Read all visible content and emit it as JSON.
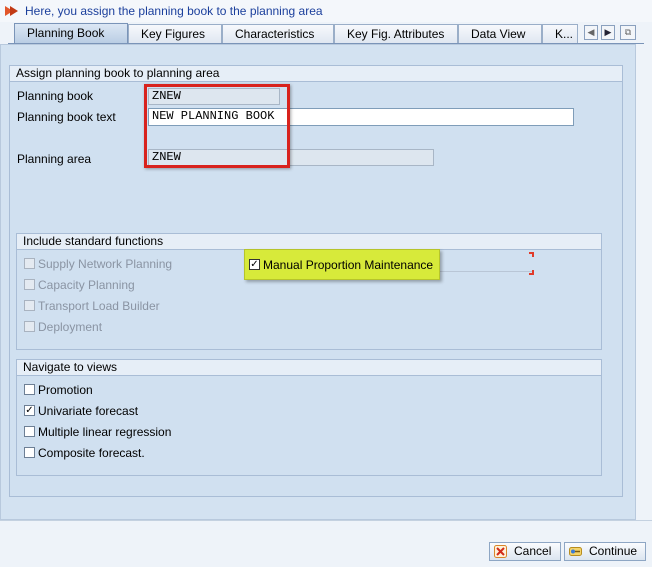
{
  "hint": {
    "text": "Here, you assign the planning book to the planning area",
    "icon": "arrow-right-icon"
  },
  "tabs": [
    {
      "label": "Planning Book",
      "active": true
    },
    {
      "label": "Key Figures",
      "active": false
    },
    {
      "label": "Characteristics",
      "active": false
    },
    {
      "label": "Key Fig. Attributes",
      "active": false
    },
    {
      "label": "Data View",
      "active": false
    },
    {
      "label": "K...",
      "active": false
    }
  ],
  "assign": {
    "title": "Assign planning book to planning area",
    "planning_book_label": "Planning book",
    "planning_book_value": "ZNEW",
    "planning_book_text_label": "Planning book text",
    "planning_book_text_value": "NEW PLANNING BOOK",
    "planning_area_label": "Planning area",
    "planning_area_value": "ZNEW"
  },
  "standard_functions": {
    "title": "Include standard functions",
    "items": [
      {
        "label": "Supply Network Planning",
        "checked": false,
        "enabled": false
      },
      {
        "label": "Capacity Planning",
        "checked": false,
        "enabled": false
      },
      {
        "label": "Transport Load Builder",
        "checked": false,
        "enabled": false
      },
      {
        "label": "Deployment",
        "checked": false,
        "enabled": false
      }
    ],
    "manual_proportion": {
      "label": "Manual Proportion Maintenance",
      "checked": true,
      "enabled": true
    }
  },
  "views": {
    "title": "Navigate to views",
    "items": [
      {
        "label": "Promotion",
        "checked": false
      },
      {
        "label": "Univariate forecast",
        "checked": true
      },
      {
        "label": "Multiple linear regression",
        "checked": false
      },
      {
        "label": "Composite forecast.",
        "checked": false
      }
    ]
  },
  "buttons": {
    "cancel_label": "Cancel",
    "continue_label": "Continue"
  },
  "colors": {
    "highlight_red": "#d8221d",
    "highlight_yellow": "#d7ea3a",
    "hint_text": "#1b3f9c"
  }
}
